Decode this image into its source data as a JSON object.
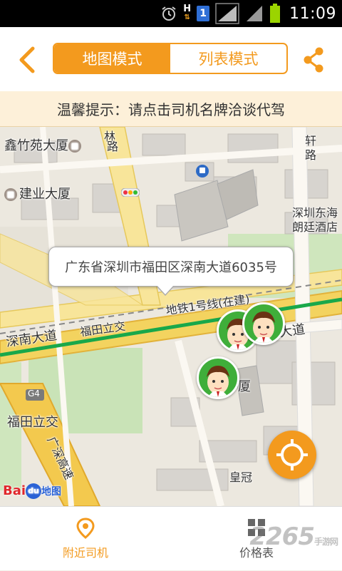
{
  "status_bar": {
    "time": "11:09",
    "sim_label": "1",
    "data_indicator": "H",
    "icons": [
      "alarm-icon",
      "data-arrows-icon",
      "sim-card-icon",
      "signal-icon",
      "signal-icon",
      "battery-icon"
    ]
  },
  "header": {
    "back_icon": "chevron-left-icon",
    "share_icon": "share-icon",
    "tabs": [
      {
        "label": "地图模式",
        "active": true
      },
      {
        "label": "列表模式",
        "active": false
      }
    ],
    "accent_color": "#f39a1e"
  },
  "tip": {
    "text": "温馨提示：请点击司机名牌洽谈代驾"
  },
  "map": {
    "callout_address": "广东省深圳市福田区深南大道6035号",
    "labels": {
      "xinzhuyuan": "鑫竹苑大厦",
      "jianye": "建业大厦",
      "shenzhen_hotel_1": "深圳东海",
      "shenzhen_hotel_2": "朗廷酒店",
      "metro_line": "地铁1号线(在建)",
      "shennan_road_left": "深南大道",
      "futian_interchange_road": "福田立交",
      "shennan_road_right": "大道",
      "futian_interchange": "福田立交",
      "g4": "G4",
      "guangshen_expressway": "广深高速",
      "crown_hotel": "皇冠",
      "xia": "厦",
      "lu": "路",
      "xuan": "轩",
      "lin": "林",
      "road_vertical_right": "路"
    },
    "logo": {
      "bai": "Bai",
      "du": "du",
      "ditu": "地图"
    },
    "drivers_count": 3,
    "locate_icon": "locate-target-icon"
  },
  "tabbar": {
    "tabs": [
      {
        "label": "附近司机",
        "icon": "location-pin-icon",
        "active": true
      },
      {
        "label": "价格表",
        "icon": "price-list-icon",
        "active": false
      }
    ],
    "watermark_main": "2265",
    "watermark_sub": "手游网"
  }
}
